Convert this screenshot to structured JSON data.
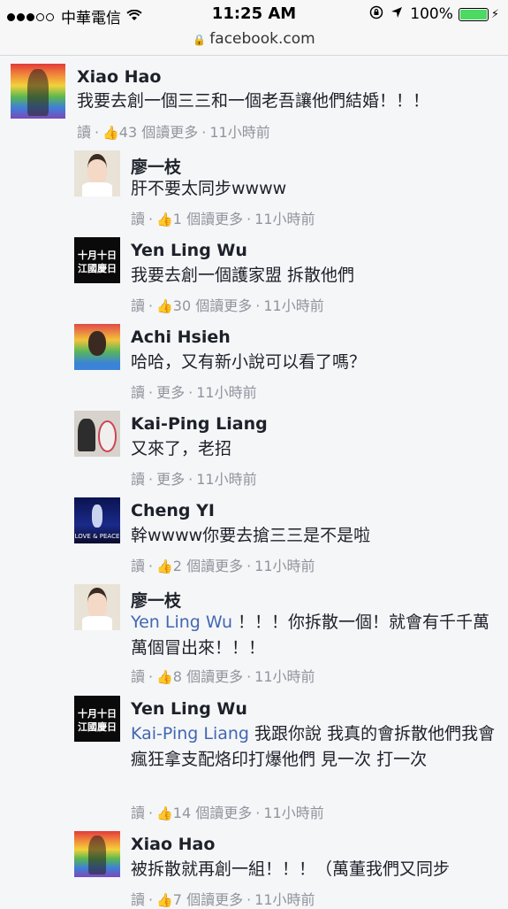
{
  "status_bar": {
    "carrier": "中華電信",
    "time": "11:25 AM",
    "battery": "100%"
  },
  "url_bar": {
    "domain": "facebook.com"
  },
  "comments": [
    {
      "name": "Xiao Hao",
      "text": "我要去創一個三三和一個老吾讓他們結婚！！！",
      "read": "讀",
      "likes": "43 個讀更多",
      "time": "11小時前",
      "avatar": "rainbow-portrait"
    },
    {
      "name": "廖一枝",
      "text": "肝不要太同步wwww",
      "read": "讀",
      "likes": "1 個讀更多",
      "time": "11小時前",
      "avatar": "girl-portrait"
    },
    {
      "name": "Yen Ling Wu",
      "text": "我要去創一個護家盟 拆散他們",
      "read": "讀",
      "likes": "30 個讀更多",
      "time": "11小時前",
      "avatar": "black-text-logo",
      "avatar_text": [
        "十月十日",
        "江國慶日"
      ]
    },
    {
      "name": "Achi Hsieh",
      "text": "哈哈，又有新小說可以看了嗎？",
      "read": "讀",
      "more": "更多",
      "time": "11小時前",
      "avatar": "rainbow-portrait"
    },
    {
      "name": "Kai-Ping Liang",
      "text": "又來了，老招",
      "read": "讀",
      "more": "更多",
      "time": "11小時前",
      "avatar": "two-people"
    },
    {
      "name": "Cheng YI",
      "text": "幹wwww你要去搶三三是不是啦",
      "read": "讀",
      "likes": "2 個讀更多",
      "time": "11小時前",
      "avatar": "concert-stage",
      "avatar_text": "LOVE & PEACE"
    },
    {
      "name": "廖一枝",
      "mention": "Yen Ling Wu",
      "text": " ！！！你拆散一個！就會有千千萬萬個冒出來！！！",
      "read": "讀",
      "likes": "8 個讀更多",
      "time": "11小時前",
      "avatar": "girl-portrait"
    },
    {
      "name": "Yen Ling Wu",
      "mention": "Kai-Ping Liang",
      "text": " 我跟你說 我真的會拆散他們我會瘋狂拿支配烙印打爆他們 見一次 打一次",
      "read": "讀",
      "likes": "14 個讀更多",
      "time": "11小時前",
      "avatar": "black-text-logo",
      "avatar_text": [
        "十月十日",
        "江國慶日"
      ]
    },
    {
      "name": "Xiao Hao",
      "text": "被拆散就再創一組！！！（萬董我們又同步",
      "read": "讀",
      "likes": "7 個讀更多",
      "time": "11小時前",
      "avatar": "rainbow-portrait"
    }
  ],
  "icons": {
    "like": "thumbs-up-icon",
    "lock": "lock-icon",
    "wifi": "wifi-icon",
    "location": "location-arrow-icon",
    "rotation": "rotation-lock-icon"
  },
  "colors": {
    "mention": "#4267b2",
    "meta": "#90949c",
    "background": "#f5f6f8"
  }
}
